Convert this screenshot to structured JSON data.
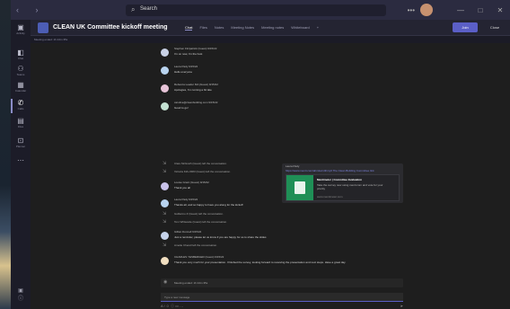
{
  "search": {
    "placeholder": "Search"
  },
  "meeting": {
    "title": "CLEAN UK Committee kickoff meeting",
    "tabs": [
      "Chat",
      "Files",
      "Notes",
      "Meeting Notes",
      "Meeting notes",
      "Whiteboard",
      "+"
    ],
    "join_label": "Join",
    "close_label": "Close",
    "strip_text": "Meeting ended: 1h 24m 35s"
  },
  "rail": {
    "items": [
      {
        "icon": "▣",
        "label": "Activity"
      },
      {
        "icon": "◧",
        "label": "Chat"
      },
      {
        "icon": "⚇",
        "label": "Teams"
      },
      {
        "icon": "▦",
        "label": "Calendar"
      },
      {
        "icon": "✆",
        "label": "Calls"
      },
      {
        "icon": "▤",
        "label": "Files"
      },
      {
        "icon": "⊡",
        "label": "Planner"
      },
      {
        "icon": "⋯",
        "label": ""
      }
    ],
    "bottom": [
      "▣",
      "ⓘ"
    ]
  },
  "messages": [
    {
      "kind": "msg",
      "name": "Stephen Fitzpatrick (Guest)  9/15/22",
      "text": "I'm on now, I'm the host",
      "color": "#c9d2e6"
    },
    {
      "kind": "msg",
      "name": "Laura Pady  9/15/22",
      "text": "Hello everyone",
      "color": "#b9d4f0"
    },
    {
      "kind": "msg",
      "name": "Rebecca Leader MA (Guest)  9/15/22",
      "text": "Apologies, I'm running a bit late",
      "color": "#e7c4d8"
    },
    {
      "kind": "msg",
      "name": "caroline@cleanbuilding.com  9/15/22",
      "text": "Good to go!",
      "color": "#c4e1d2"
    },
    {
      "kind": "sys",
      "text": "Clare McGrath (Guest) left the conversation."
    },
    {
      "kind": "sys",
      "text": "Victoria Kirk-ORR (Guest) left the conversation."
    },
    {
      "kind": "msg",
      "name": "Louise Grant (Guest)  9/15/22",
      "text": "Thank you all",
      "color": "#c9c2ea"
    },
    {
      "kind": "msg",
      "name": "Laura Pady  9/15/22",
      "text": "Thanks all, and so happy to have you along for the kickoff",
      "color": "#b9d4f0"
    },
    {
      "kind": "sys",
      "text": "Guillermo Z (Guest) left the conversation."
    },
    {
      "kind": "sys",
      "text": "Tom Whiteside (Guest) left the conversation."
    },
    {
      "kind": "msg",
      "name": "Gillian Donnell  9/15/22",
      "text": "Just a reminder, please let us know if you are happy for us to share the slides",
      "color": "#c6d3ea"
    },
    {
      "kind": "sys",
      "text": "Amelie Cherell left the conversation."
    },
    {
      "kind": "msg",
      "name": "CHARLES YESBERGER (Guest)  9/15/22",
      "text": "Thank you very much for your presentation. I finished the survey, looking forward to receiving the presentation and next steps. Have a great day.",
      "color": "#f1dec0"
    }
  ],
  "card": {
    "meta": "Laura Pady",
    "url": "https://www.menti.com/al1mkvm4hmy9 The Clean Building Committee link",
    "title": "Mentimeter | Committee Evaluation",
    "desc": "Take the survey now using menti.com and vote for your priority",
    "link": "www.mentimeter.com"
  },
  "reply": {
    "text": "Meeting ended: 1h 24m 35s"
  },
  "compose": {
    "placeholder": "Type a new message",
    "tools": "A  !  ☺  ⓘ  ▭  ⋯",
    "send": "➤"
  },
  "window": {
    "controls": [
      "—",
      "□",
      "✕"
    ]
  },
  "nav": {
    "arrows": "‹ ›"
  }
}
